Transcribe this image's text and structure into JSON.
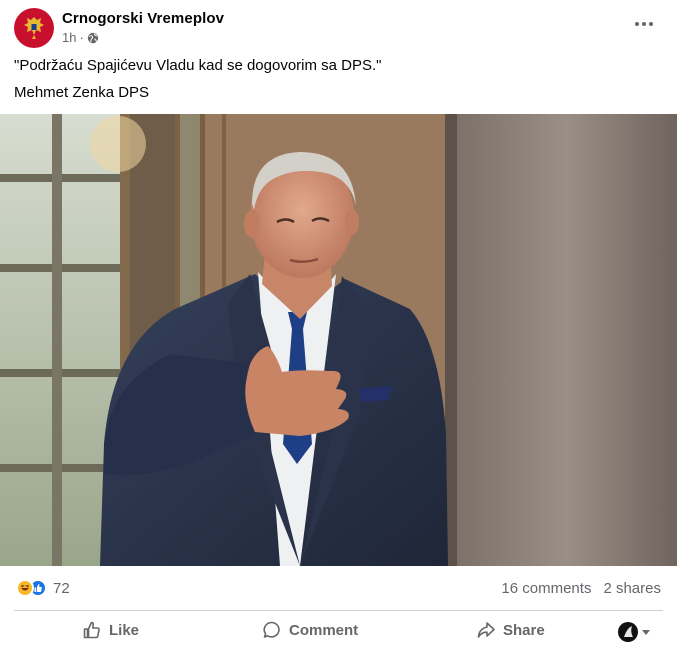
{
  "post": {
    "page_name": "Crnogorski Vremeplov",
    "time": "1h",
    "separator": "·",
    "audience_icon": "globe-icon",
    "more_icon": "more-dots-icon",
    "text_lines": [
      "\"Podržaću Spajićevu Vladu kad se dogovorim sa DPS.\"",
      "Mehmet Zenka DPS"
    ]
  },
  "stats": {
    "reaction_icons": [
      "haha-reaction-icon",
      "like-reaction-icon"
    ],
    "reaction_count": "72",
    "comments": "16 comments",
    "shares": "2 shares"
  },
  "actions": {
    "like": "Like",
    "comment": "Comment",
    "share": "Share"
  },
  "colors": {
    "text_primary": "#050505",
    "text_secondary": "#65676b",
    "like_blue": "#1b74e4",
    "haha_yellow": "#f7b928",
    "avatar_red": "#c8102e",
    "divider": "#ced0d4"
  }
}
